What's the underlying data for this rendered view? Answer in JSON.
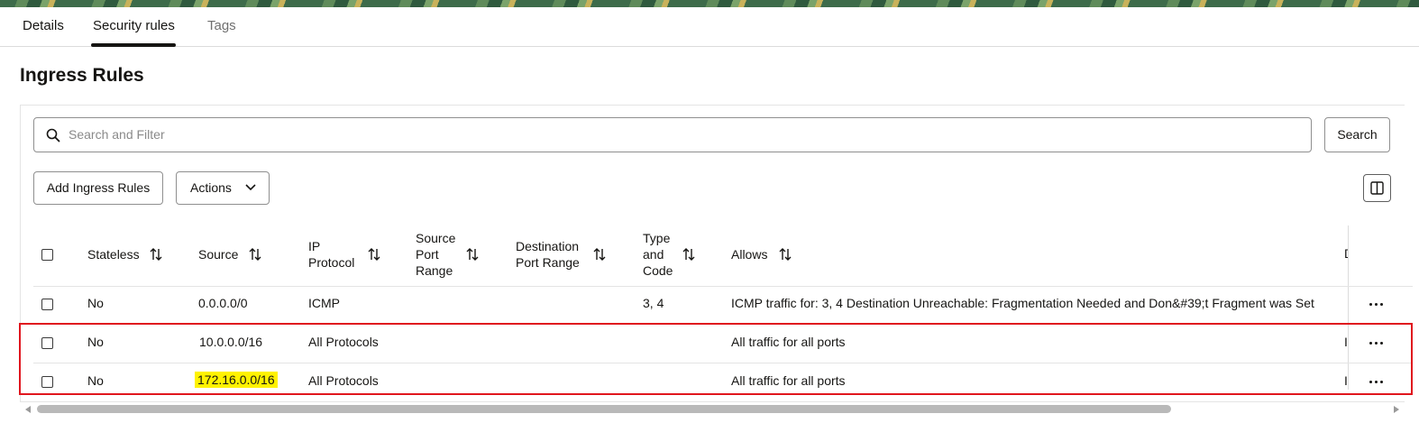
{
  "tabs": [
    {
      "label": "Details"
    },
    {
      "label": "Security rules"
    },
    {
      "label": "Tags"
    }
  ],
  "section_title": "Ingress Rules",
  "search": {
    "placeholder": "Search and Filter",
    "button_label": "Search"
  },
  "toolbar": {
    "add_label": "Add Ingress Rules",
    "actions_label": "Actions"
  },
  "table": {
    "columns": [
      {
        "line1": "Stateless",
        "line2": "",
        "line3": ""
      },
      {
        "line1": "Source",
        "line2": "",
        "line3": ""
      },
      {
        "line1": "IP",
        "line2": "Protocol",
        "line3": ""
      },
      {
        "line1": "Source",
        "line2": "Port",
        "line3": "Range"
      },
      {
        "line1": "Destination",
        "line2": "Port Range",
        "line3": ""
      },
      {
        "line1": "Type",
        "line2": "and",
        "line3": "Code"
      },
      {
        "line1": "Allows",
        "line2": "",
        "line3": ""
      }
    ],
    "truncated_header": "D",
    "rows": [
      {
        "stateless": "No",
        "source": "0.0.0.0/0",
        "protocol": "ICMP",
        "source_port": "",
        "dest_port": "",
        "type_code": "3, 4",
        "allows": "ICMP traffic for: 3, 4 Destination Unreachable: Fragmentation Needed and Don&#39;t Fragment was Set",
        "trunc": ""
      },
      {
        "stateless": "No",
        "source": "10.0.0.0/16",
        "protocol": "All Protocols",
        "source_port": "",
        "dest_port": "",
        "type_code": "",
        "allows": "All traffic for all ports",
        "trunc": "I"
      },
      {
        "stateless": "No",
        "source": "172.16.0.0/16",
        "protocol": "All Protocols",
        "source_port": "",
        "dest_port": "",
        "type_code": "",
        "allows": "All traffic for all ports",
        "trunc": "I"
      }
    ]
  },
  "colors": {
    "highlight": "#fff200",
    "selection_border": "#e0161e",
    "text": "#161513"
  }
}
